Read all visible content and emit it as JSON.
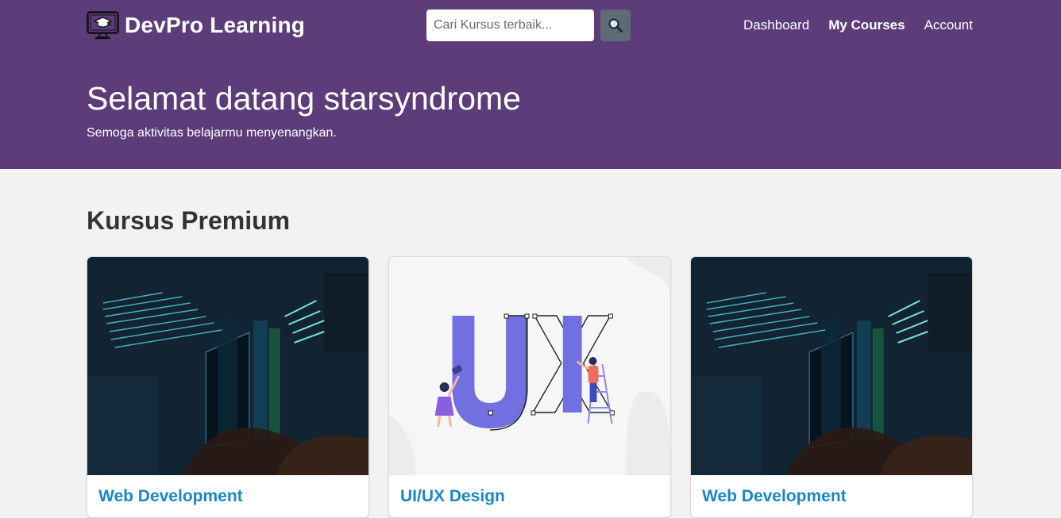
{
  "brand": {
    "name": "DevPro Learning",
    "icon": "monitor-graduation-cap-icon"
  },
  "search": {
    "placeholder": "Cari Kursus terbaik...",
    "value": "",
    "button_icon": "magnifier-icon"
  },
  "nav": {
    "items": [
      {
        "label": "Dashboard",
        "active": false
      },
      {
        "label": "My Courses",
        "active": true
      },
      {
        "label": "Account",
        "active": false
      }
    ]
  },
  "hero": {
    "title": "Selamat datang starsyndrome",
    "subtitle": "Semoga aktivitas belajarmu menyenangkan."
  },
  "section": {
    "title": "Kursus Premium"
  },
  "courses": [
    {
      "title": "Web Development",
      "image": "code-screen-image"
    },
    {
      "title": "UI/UX Design",
      "image": "ux-illustration-image"
    },
    {
      "title": "Web Development",
      "image": "code-screen-image"
    }
  ],
  "colors": {
    "header_bg": "#5c3d7a",
    "page_bg": "#f2f2f2",
    "link": "#1a86c8",
    "search_button": "#5f6b74"
  }
}
